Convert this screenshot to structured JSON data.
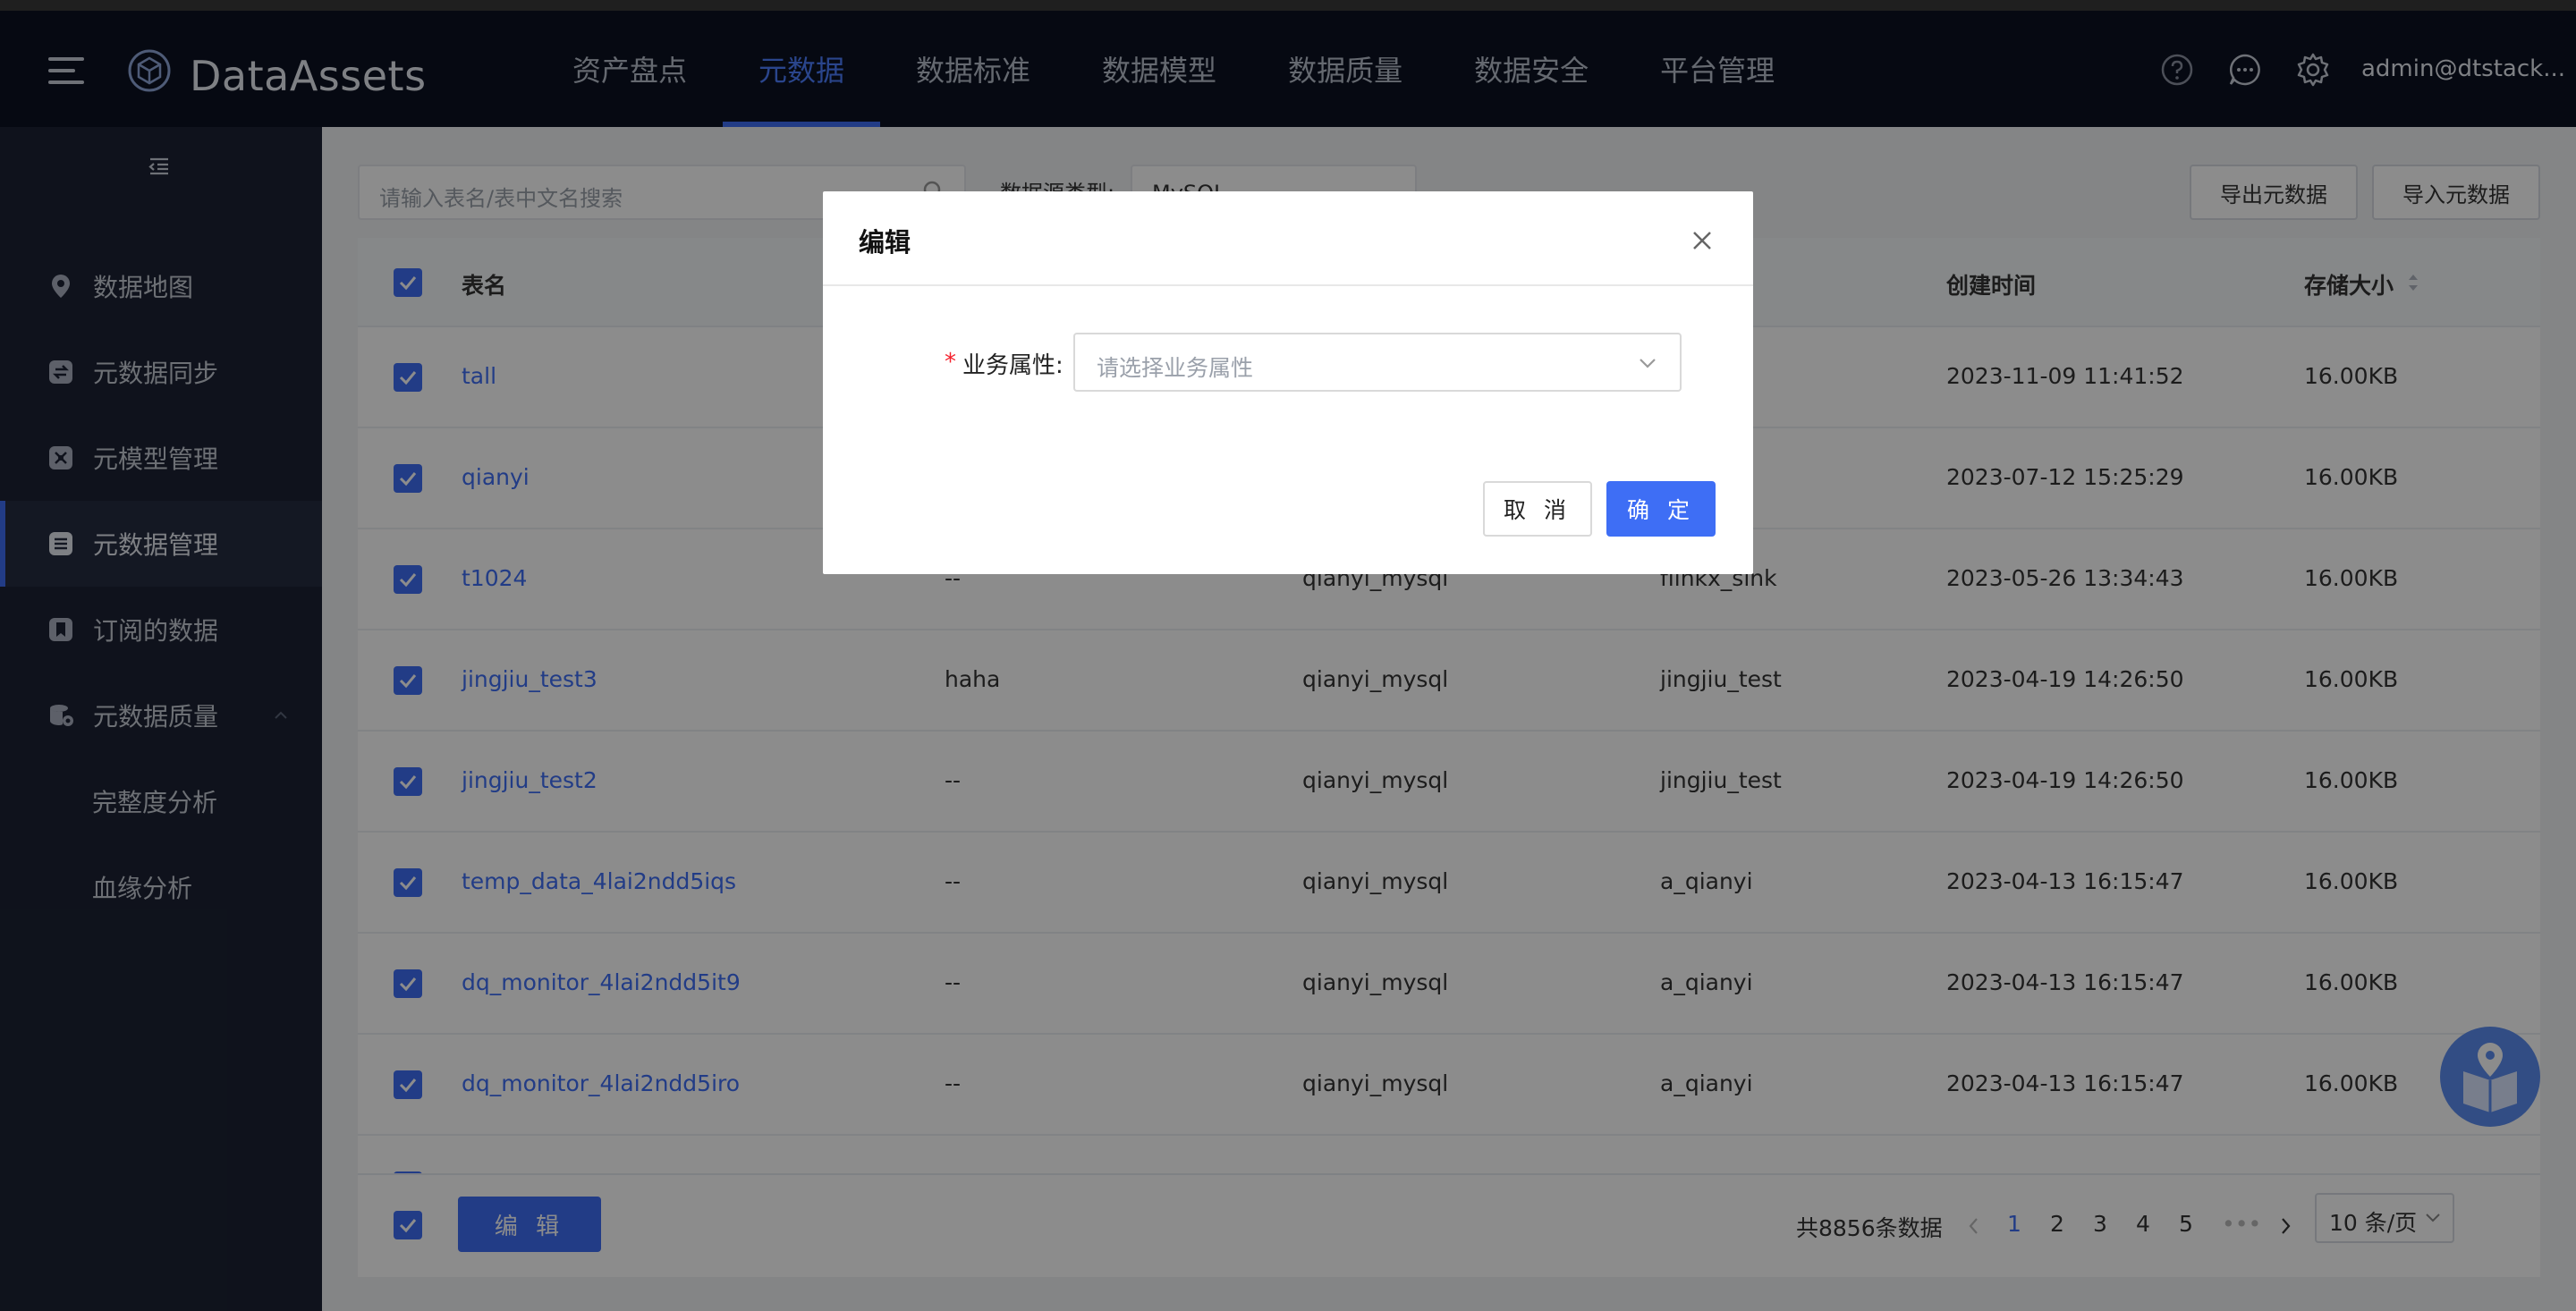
{
  "app": {
    "brand": "DataAssets",
    "user": "admin@dtstack..."
  },
  "nav": [
    {
      "label": "资产盘点"
    },
    {
      "label": "元数据",
      "active": true
    },
    {
      "label": "数据标准"
    },
    {
      "label": "数据模型"
    },
    {
      "label": "数据质量"
    },
    {
      "label": "数据安全"
    },
    {
      "label": "平台管理"
    }
  ],
  "header_icons": [
    "help-icon",
    "message-icon",
    "gear-icon"
  ],
  "sidebar": {
    "items": [
      {
        "label": "数据地图",
        "icon": "location-icon"
      },
      {
        "label": "元数据同步",
        "icon": "sync-icon"
      },
      {
        "label": "元模型管理",
        "icon": "model-icon"
      },
      {
        "label": "元数据管理",
        "icon": "database-icon",
        "active": true
      },
      {
        "label": "订阅的数据",
        "icon": "bookmark-icon"
      },
      {
        "label": "元数据质量",
        "icon": "quality-icon",
        "expanded": true
      },
      {
        "label": "完整度分析",
        "sub": true
      },
      {
        "label": "血缘分析",
        "sub": true
      }
    ]
  },
  "toolbar": {
    "search_placeholder": "请输入表名/表中文名搜索",
    "filter_label": "数据源类型:",
    "filter_value": "MySQL",
    "export_label": "导出元数据",
    "import_label": "导入元数据"
  },
  "table": {
    "columns": [
      "表名",
      "",
      "",
      "",
      "创建时间",
      "存储大小"
    ],
    "rows": [
      {
        "name": "tall",
        "desc": "",
        "source": "",
        "db": "",
        "created": "2023-11-09 11:41:52",
        "size": "16.00KB"
      },
      {
        "name": "qianyi",
        "desc": "",
        "source": "",
        "db": "",
        "created": "2023-07-12 15:25:29",
        "size": "16.00KB"
      },
      {
        "name": "t1024",
        "desc": "--",
        "source": "qianyi_mysql",
        "db": "flinkx_sink",
        "created": "2023-05-26 13:34:43",
        "size": "16.00KB"
      },
      {
        "name": "jingjiu_test3",
        "desc": "haha",
        "source": "qianyi_mysql",
        "db": "jingjiu_test",
        "created": "2023-04-19 14:26:50",
        "size": "16.00KB"
      },
      {
        "name": "jingjiu_test2",
        "desc": "--",
        "source": "qianyi_mysql",
        "db": "jingjiu_test",
        "created": "2023-04-19 14:26:50",
        "size": "16.00KB"
      },
      {
        "name": "temp_data_4lai2ndd5iqs",
        "desc": "--",
        "source": "qianyi_mysql",
        "db": "a_qianyi",
        "created": "2023-04-13 16:15:47",
        "size": "16.00KB"
      },
      {
        "name": "dq_monitor_4lai2ndd5it9",
        "desc": "--",
        "source": "qianyi_mysql",
        "db": "a_qianyi",
        "created": "2023-04-13 16:15:47",
        "size": "16.00KB"
      },
      {
        "name": "dq_monitor_4lai2ndd5iro",
        "desc": "--",
        "source": "qianyi_mysql",
        "db": "a_qianyi",
        "created": "2023-04-13 16:15:47",
        "size": "16.00KB"
      }
    ]
  },
  "footer": {
    "edit_label": "编 辑",
    "total": "共8856条数据",
    "pages": [
      "1",
      "2",
      "3",
      "4",
      "5"
    ],
    "ellipsis": "•••",
    "page_size": "10 条/页"
  },
  "modal": {
    "title": "编辑",
    "field_label": "业务属性:",
    "field_required": "*",
    "select_placeholder": "请选择业务属性",
    "cancel_label": "取 消",
    "ok_label": "确 定"
  },
  "colors": {
    "accent": "#3e6ef5",
    "header_bg": "#0b1222",
    "sidebar_bg": "#1c2233"
  }
}
